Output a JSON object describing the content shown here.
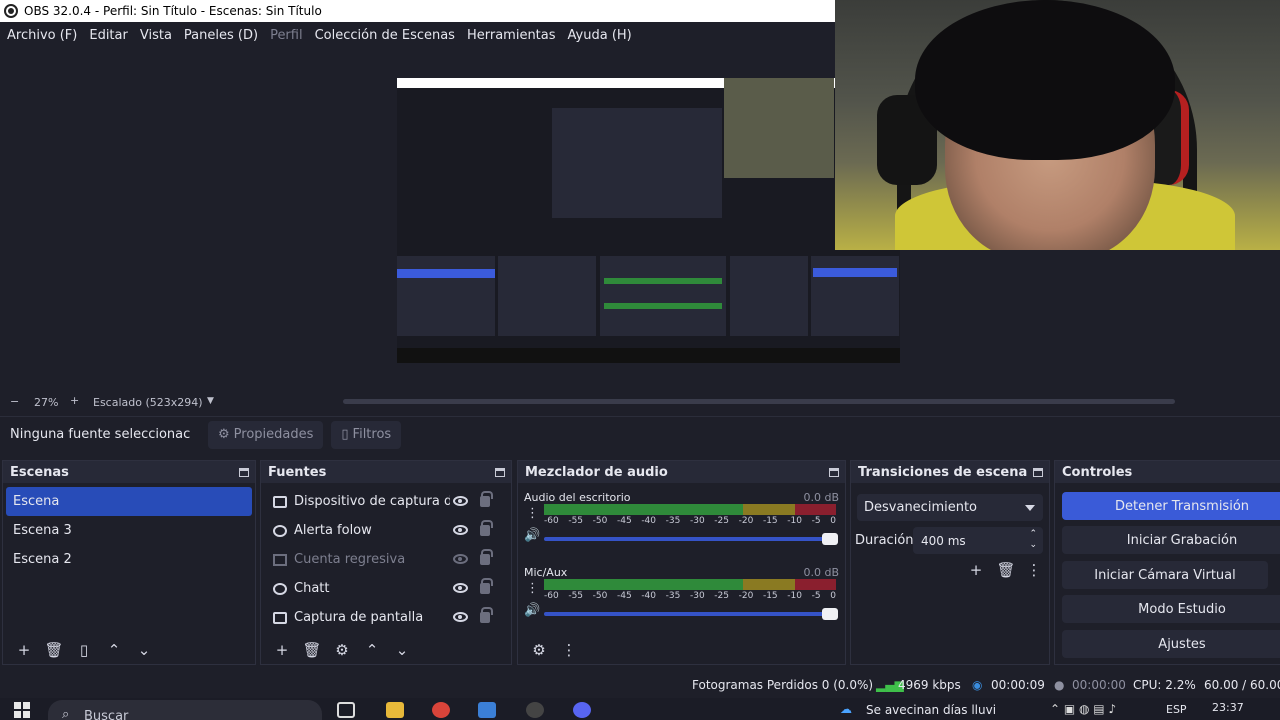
{
  "window": {
    "title": "OBS 32.0.4 - Perfil: Sin Título - Escenas: Sin Título"
  },
  "menu": [
    {
      "label": "Archivo (F)",
      "enabled": true
    },
    {
      "label": "Editar",
      "enabled": true
    },
    {
      "label": "Vista",
      "enabled": true
    },
    {
      "label": "Paneles (D)",
      "enabled": true
    },
    {
      "label": "Perfil",
      "enabled": false
    },
    {
      "label": "Colección de Escenas",
      "enabled": true
    },
    {
      "label": "Herramientas",
      "enabled": true
    },
    {
      "label": "Ayuda (H)",
      "enabled": true
    }
  ],
  "zoombar": {
    "zoom": "27%",
    "scale_mode": "Escalado (523x294)"
  },
  "context": {
    "no_source": "Ninguna fuente seleccionac",
    "properties": "Propiedades",
    "filters": "Filtros"
  },
  "scenes": {
    "title": "Escenas",
    "items": [
      {
        "label": "Escena",
        "selected": true
      },
      {
        "label": "Escena 3",
        "selected": false
      },
      {
        "label": "Escena 2",
        "selected": false
      }
    ]
  },
  "sources": {
    "title": "Fuentes",
    "items": [
      {
        "label": "Dispositivo de captura de v",
        "icon": "camera-icon",
        "visible": true
      },
      {
        "label": "Alerta folow",
        "icon": "globe-icon",
        "visible": true
      },
      {
        "label": "Cuenta regresiva",
        "icon": "text-icon",
        "visible": false
      },
      {
        "label": "Chatt",
        "icon": "globe-icon",
        "visible": true
      },
      {
        "label": "Captura de pantalla",
        "icon": "monitor-icon",
        "visible": true
      }
    ]
  },
  "mixer": {
    "title": "Mezclador de audio",
    "ticks": [
      "-60",
      "-55",
      "-50",
      "-45",
      "-40",
      "-35",
      "-30",
      "-25",
      "-20",
      "-15",
      "-10",
      "-5",
      "0"
    ],
    "channels": [
      {
        "name": "Audio del escritorio",
        "db": "0.0 dB"
      },
      {
        "name": "Mic/Aux",
        "db": "0.0 dB"
      }
    ]
  },
  "transitions": {
    "title": "Transiciones de escena",
    "selected": "Desvanecimiento",
    "duration_label": "Duración",
    "duration_value": "400 ms"
  },
  "controls": {
    "title": "Controles",
    "buttons": [
      {
        "label": "Detener Transmisión",
        "active": true
      },
      {
        "label": "Iniciar Grabación",
        "active": false
      },
      {
        "label": "Iniciar Cámara Virtual",
        "active": false
      },
      {
        "label": "Modo Estudio",
        "active": false
      },
      {
        "label": "Ajustes",
        "active": false
      }
    ]
  },
  "status": {
    "dropped_frames": "Fotogramas Perdidos 0 (0.0%)",
    "bitrate": "4969 kbps",
    "stream_time": "00:00:09",
    "record_time": "00:00:00",
    "cpu": "CPU: 2.2%",
    "fps": "60.00 / 60.00"
  },
  "taskbar": {
    "search_placeholder": "Buscar",
    "weather": "Se avecinan días lluvi",
    "language": "ESP",
    "time": "23:37"
  },
  "colors": {
    "accent": "#284cb8",
    "active_button": "#3a5bd8",
    "background": "#1e1f29",
    "panel": "#272937"
  }
}
